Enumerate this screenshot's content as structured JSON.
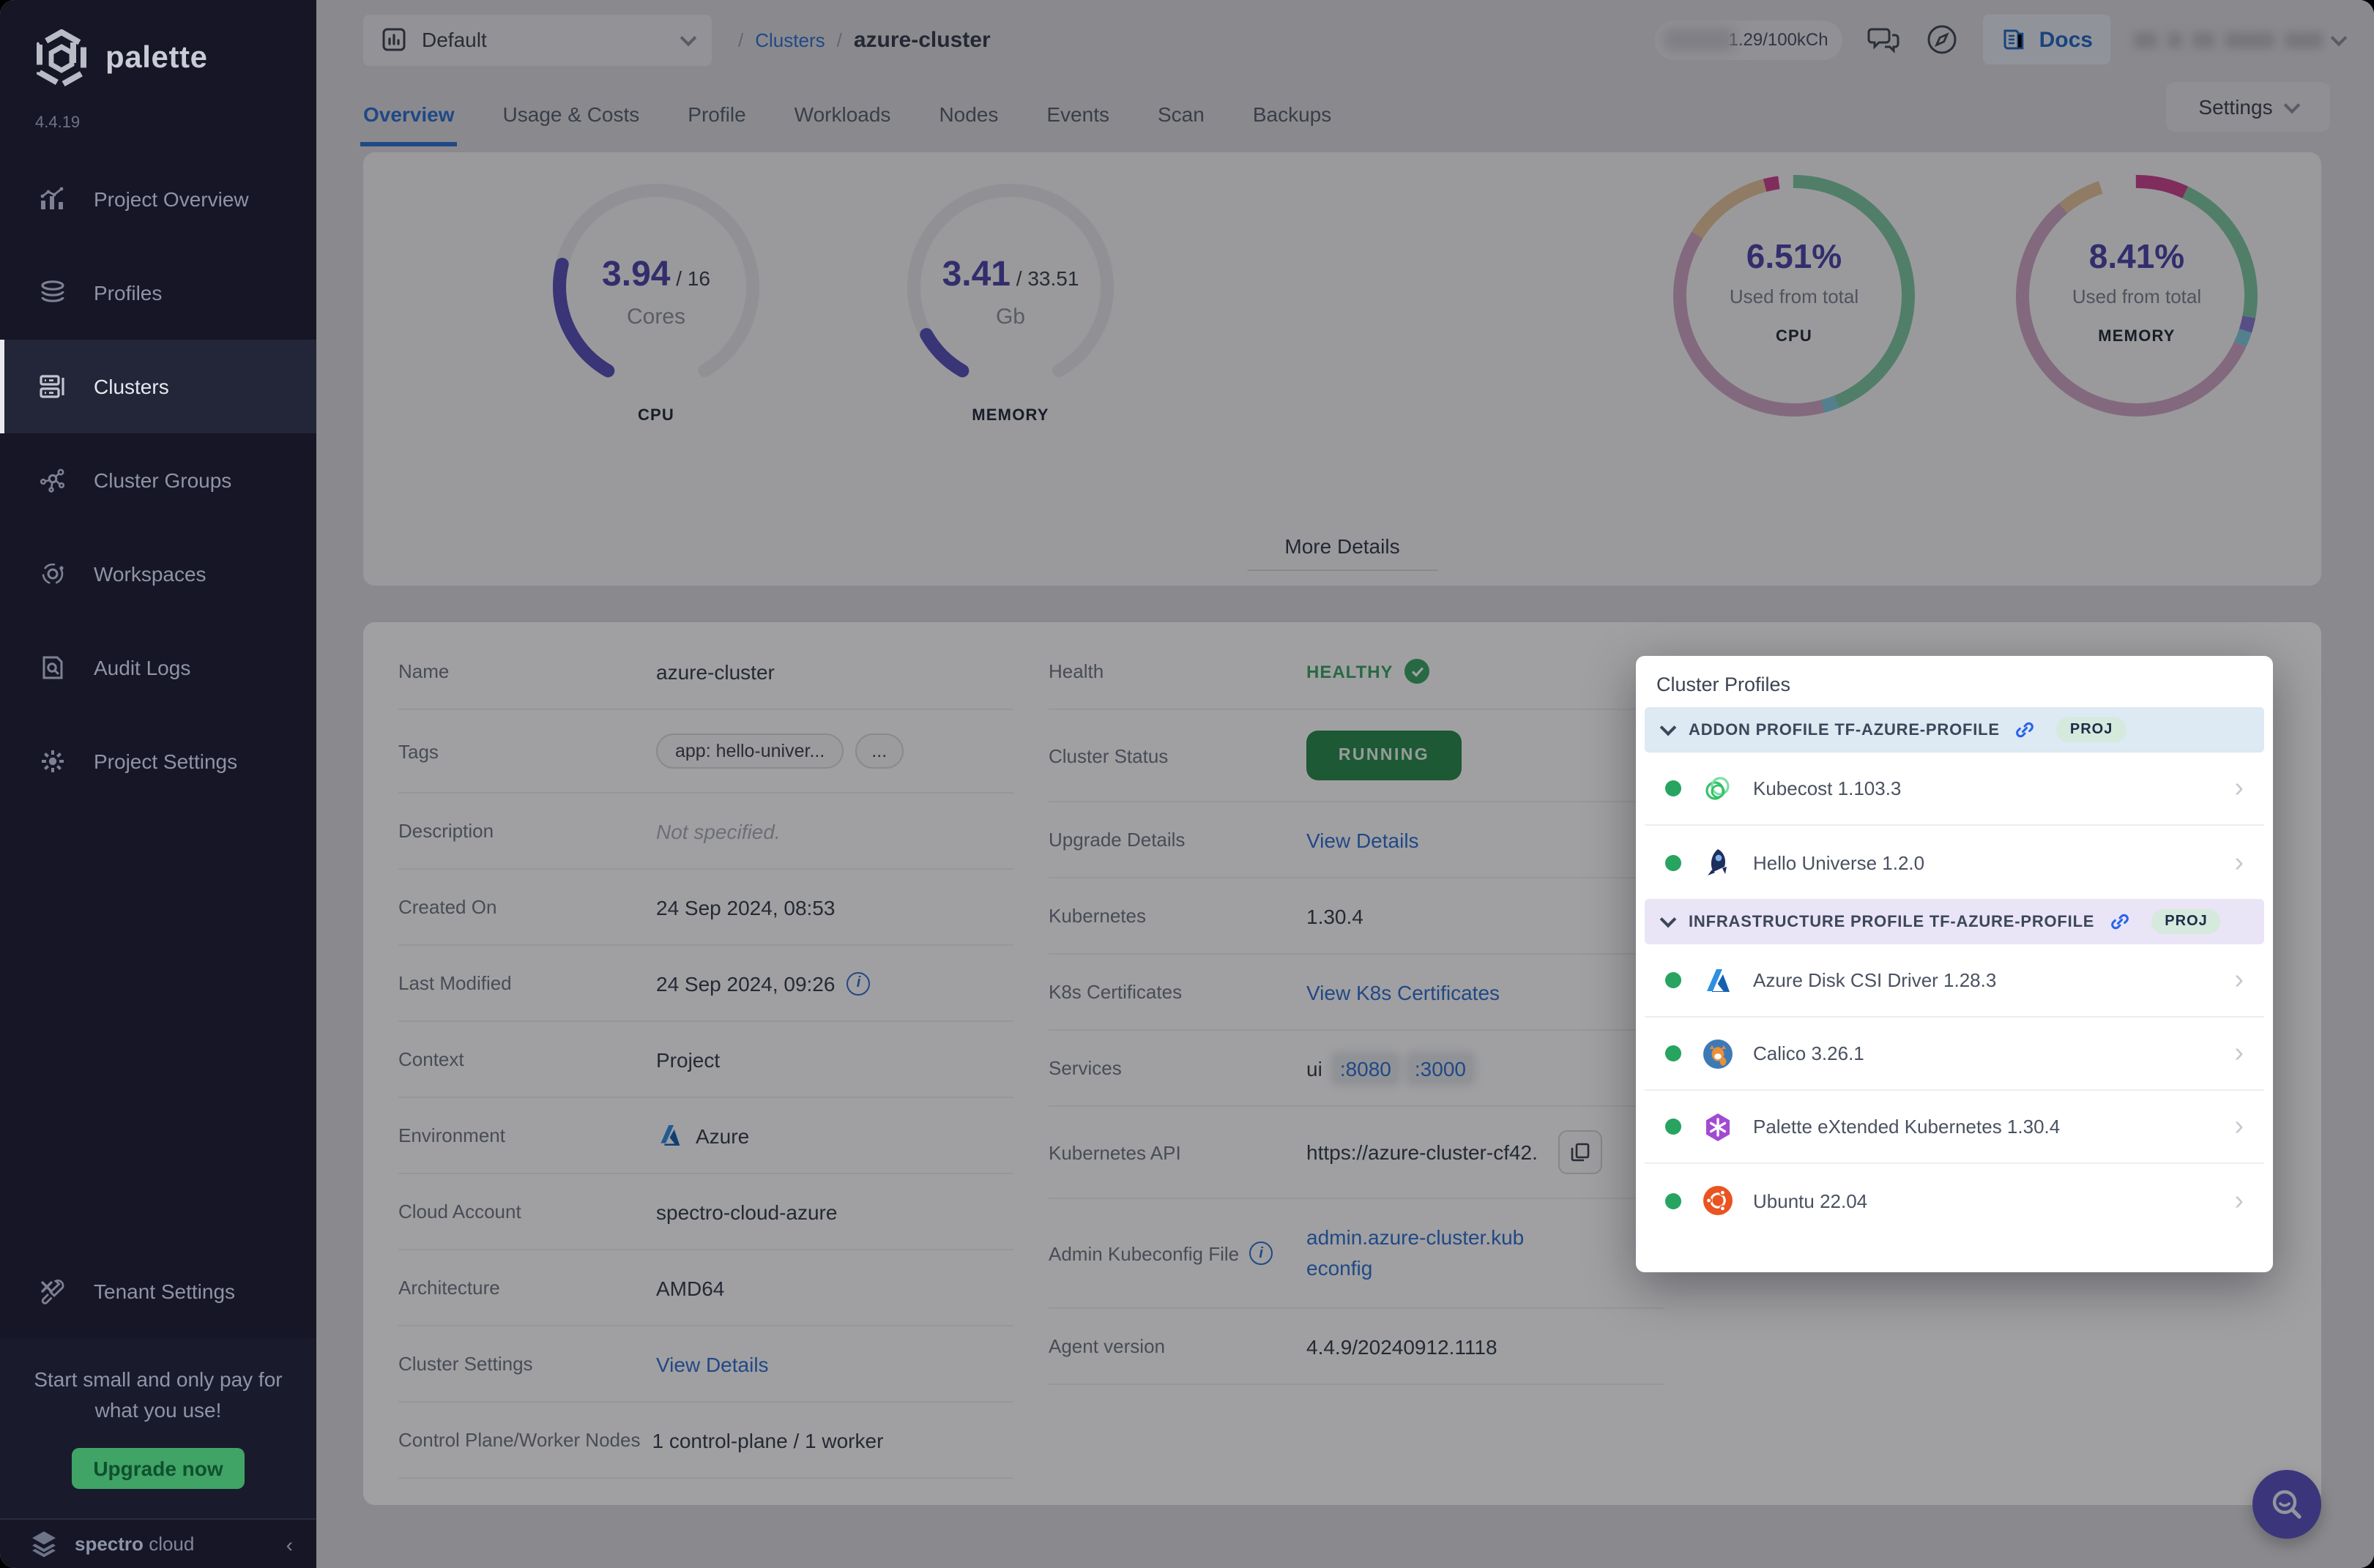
{
  "app": {
    "title": "palette",
    "version": "4.4.19"
  },
  "colors": {
    "accent_blue": "#2f6fd0",
    "indigo": "#564fb8",
    "green_running": "#27894d",
    "green_healthy": "#3aa364",
    "upgrade_green": "#3fa465",
    "donut_green": "#7cc5a0",
    "donut_pink": "#cda4c4",
    "donut_tan": "#e2c199",
    "donut_magenta": "#c9418f",
    "donut_cyan": "#7ec8dd",
    "donut_purple": "#8678d0"
  },
  "sidebar": {
    "items": [
      {
        "label": "Project Overview",
        "icon": "chart-icon"
      },
      {
        "label": "Profiles",
        "icon": "layers-icon"
      },
      {
        "label": "Clusters",
        "icon": "server-icon",
        "selected": true
      },
      {
        "label": "Cluster Groups",
        "icon": "network-icon"
      },
      {
        "label": "Workspaces",
        "icon": "orbit-icon"
      },
      {
        "label": "Audit Logs",
        "icon": "audit-icon"
      },
      {
        "label": "Project Settings",
        "icon": "gear-icon"
      }
    ],
    "tenant": {
      "label": "Tenant Settings",
      "icon": "tools-icon"
    },
    "upsell": {
      "text": "Start small and only pay for what you use!",
      "button": "Upgrade now"
    },
    "brand": {
      "name_bold": "spectro",
      "name_light": "cloud"
    }
  },
  "topbar": {
    "project_selector": "Default",
    "breadcrumb": {
      "sep1": "/",
      "section": "Clusters",
      "sep2": "/",
      "current": "azure-cluster"
    },
    "usage_pill": "1.29/100kCh",
    "docs_label": "Docs"
  },
  "tabs": {
    "items": [
      {
        "label": "Overview",
        "active": true
      },
      {
        "label": "Usage & Costs"
      },
      {
        "label": "Profile"
      },
      {
        "label": "Workloads"
      },
      {
        "label": "Nodes"
      },
      {
        "label": "Events"
      },
      {
        "label": "Scan"
      },
      {
        "label": "Backups"
      }
    ],
    "settings_button": "Settings"
  },
  "metrics": {
    "cpu_gauge": {
      "used": "3.94",
      "total": " / 16",
      "unit": "Cores",
      "name": "CPU",
      "fraction": 0.246
    },
    "memory_gauge": {
      "used": "3.41",
      "total": " / 33.51",
      "unit": "Gb",
      "name": "MEMORY",
      "fraction": 0.102
    },
    "cpu_donut": {
      "percent": "6.51%",
      "caption": "Used from total",
      "name": "CPU",
      "segments": [
        {
          "color": "#7cc5a0",
          "pct": 44
        },
        {
          "color": "#7ec8dd",
          "pct": 2
        },
        {
          "color": "#cda4c4",
          "pct": 38
        },
        {
          "color": "#e2c199",
          "pct": 12
        },
        {
          "color": "#c9418f",
          "pct": 2
        }
      ]
    },
    "memory_donut": {
      "percent": "8.41%",
      "caption": "Used from total",
      "name": "MEMORY",
      "segments": [
        {
          "color": "#c9418f",
          "pct": 7
        },
        {
          "color": "#7cc5a0",
          "pct": 21
        },
        {
          "color": "#8678d0",
          "pct": 2
        },
        {
          "color": "#7ec8dd",
          "pct": 2
        },
        {
          "color": "#cda4c4",
          "pct": 57
        },
        {
          "color": "#e2c199",
          "pct": 6
        }
      ]
    },
    "more_details": "More Details"
  },
  "details": {
    "left": {
      "name": {
        "label": "Name",
        "value": "azure-cluster"
      },
      "tags": {
        "label": "Tags",
        "tag1": "app: hello-univer...",
        "tag2": "..."
      },
      "description": {
        "label": "Description",
        "value": "Not specified."
      },
      "created": {
        "label": "Created On",
        "value": "24 Sep 2024, 08:53"
      },
      "modified": {
        "label": "Last Modified",
        "value": "24 Sep 2024, 09:26"
      },
      "context": {
        "label": "Context",
        "value": "Project"
      },
      "environment": {
        "label": "Environment",
        "value": "Azure"
      },
      "cloud_account": {
        "label": "Cloud Account",
        "value": "spectro-cloud-azure"
      },
      "architecture": {
        "label": "Architecture",
        "value": "AMD64"
      },
      "cluster_settings": {
        "label": "Cluster Settings",
        "value": "View Details"
      },
      "nodes": {
        "label": "Control Plane/Worker Nodes",
        "value": "1 control-plane / 1 worker"
      }
    },
    "right": {
      "health": {
        "label": "Health",
        "value": "HEALTHY"
      },
      "status": {
        "label": "Cluster Status",
        "value": "RUNNING"
      },
      "upgrade": {
        "label": "Upgrade Details",
        "value": "View Details"
      },
      "kubernetes": {
        "label": "Kubernetes",
        "value": "1.30.4"
      },
      "certs": {
        "label": "K8s Certificates",
        "value": "View K8s Certificates"
      },
      "services": {
        "label": "Services",
        "prefix": "ui",
        "port1": ":8080",
        "port2": ":3000"
      },
      "api": {
        "label": "Kubernetes API",
        "value": "https://azure-cluster-cf42..."
      },
      "kubeconfig": {
        "label": "Admin Kubeconfig File",
        "value": "admin.azure-cluster.kubeconfig"
      },
      "agent": {
        "label": "Agent version",
        "value": "4.4.9/20240912.1118"
      }
    }
  },
  "popup": {
    "title": "Cluster Profiles",
    "sections": [
      {
        "label": "ADDON PROFILE TF-AZURE-PROFILE",
        "badge": "PROJ",
        "items": [
          {
            "name": "Kubecost 1.103.3",
            "icon": "kubecost-icon"
          },
          {
            "name": "Hello Universe 1.2.0",
            "icon": "hello-universe-icon"
          }
        ]
      },
      {
        "label": "INFRASTRUCTURE PROFILE TF-AZURE-PROFILE",
        "badge": "PROJ",
        "items": [
          {
            "name": "Azure Disk CSI Driver 1.28.3",
            "icon": "azure-icon"
          },
          {
            "name": "Calico 3.26.1",
            "icon": "calico-icon"
          },
          {
            "name": "Palette eXtended Kubernetes 1.30.4",
            "icon": "pxk-icon"
          },
          {
            "name": "Ubuntu 22.04",
            "icon": "ubuntu-icon"
          }
        ]
      }
    ]
  }
}
